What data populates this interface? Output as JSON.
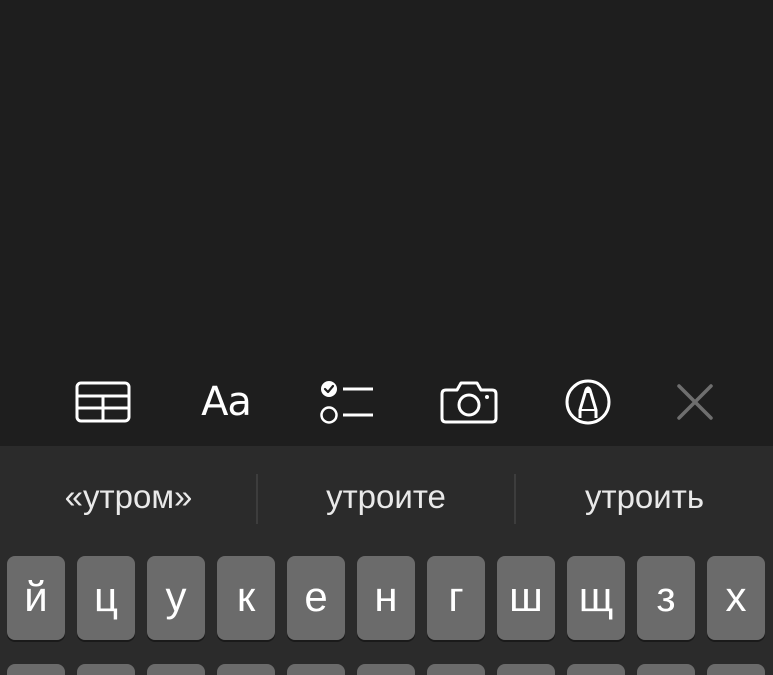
{
  "toolbar": {
    "items": [
      {
        "name": "table",
        "icon": "table-icon"
      },
      {
        "name": "format",
        "label": "Aa",
        "icon": "text-format-icon"
      },
      {
        "name": "checklist",
        "icon": "checklist-icon"
      },
      {
        "name": "camera",
        "icon": "camera-icon"
      },
      {
        "name": "markup",
        "icon": "markup-pen-icon"
      },
      {
        "name": "close",
        "icon": "close-icon"
      }
    ],
    "format_label": "Aa"
  },
  "keyboard": {
    "suggestions": [
      "«утром»",
      "утроите",
      "утроить"
    ],
    "row1": [
      "й",
      "ц",
      "у",
      "к",
      "е",
      "н",
      "г",
      "ш",
      "щ",
      "з",
      "х"
    ]
  },
  "colors": {
    "background": "#1e1e1e",
    "keyboard_bg": "#2b2b2b",
    "key_bg": "#6b6b6b",
    "icon": "#ffffff",
    "close_icon": "#6e6e6e"
  }
}
